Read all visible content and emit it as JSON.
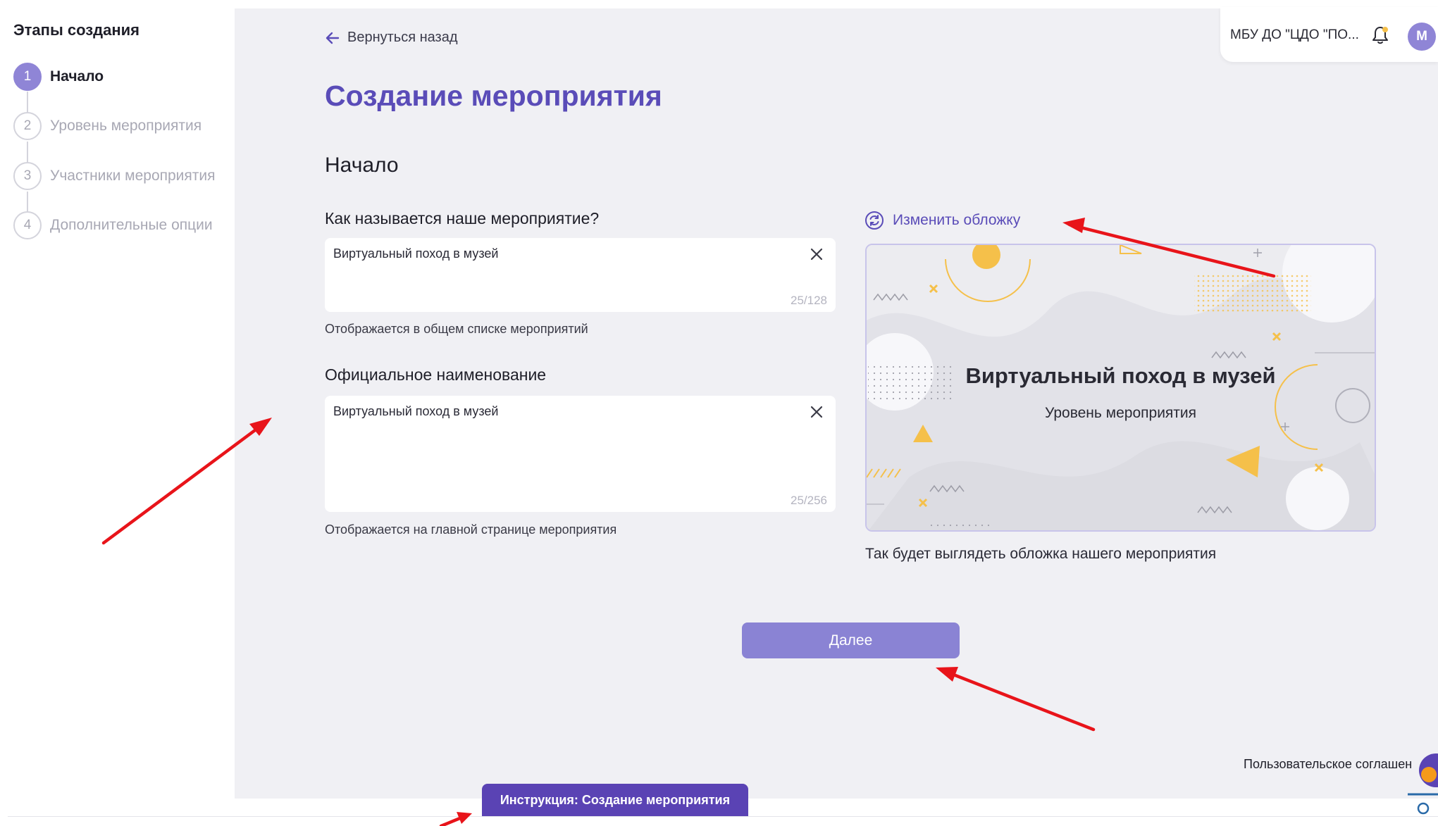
{
  "sidebar": {
    "title": "Этапы создания",
    "steps": [
      {
        "number": "1",
        "label": "Начало",
        "active": true
      },
      {
        "number": "2",
        "label": "Уровень мероприятия",
        "active": false
      },
      {
        "number": "3",
        "label": "Участники мероприятия",
        "active": false
      },
      {
        "number": "4",
        "label": "Дополнительные опции",
        "active": false
      }
    ]
  },
  "header": {
    "back_label": "Вернуться назад",
    "org_name": "МБУ ДО \"ЦДО \"ПО...",
    "avatar_letter": "М"
  },
  "main": {
    "page_title": "Создание мероприятия",
    "section_title": "Начало",
    "name_field": {
      "label": "Как называется наше мероприятие?",
      "value": "Виртуальный поход в музей",
      "counter": "25/128",
      "hint": "Отображается в общем списке мероприятий"
    },
    "official_field": {
      "label": "Официальное наименование",
      "value": "Виртуальный поход в музей",
      "counter": "25/256",
      "hint": "Отображается на главной странице мероприятия"
    },
    "cover": {
      "change_label": "Изменить обложку",
      "title": "Виртуальный поход в музей",
      "subtitle": "Уровень мероприятия",
      "caption": "Так будет выглядеть обложка нашего мероприятия"
    },
    "next_label": "Далее"
  },
  "footer": {
    "user_agreement": "Пользовательское соглашен",
    "instruction_tab": "Инструкция: Создание мероприятия"
  },
  "colors": {
    "accent": "#5a4cb8",
    "button": "#8a83d4",
    "instruction_tab": "#5a43b4",
    "step_active": "#8f85d6",
    "annotation_arrow": "#e8141a"
  },
  "icons": [
    "arrow-left-icon",
    "close-icon",
    "refresh-icon",
    "bell-icon"
  ]
}
